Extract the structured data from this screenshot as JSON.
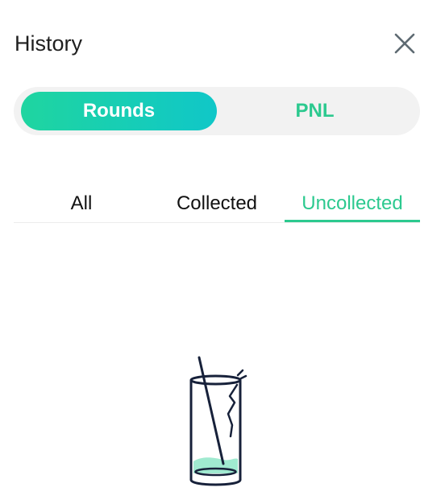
{
  "header": {
    "title": "History"
  },
  "segment": {
    "options": [
      "Rounds",
      "PNL"
    ],
    "selected": "Rounds"
  },
  "tabs": {
    "items": [
      "All",
      "Collected",
      "Uncollected"
    ],
    "selected": "Uncollected"
  },
  "icons": {
    "close": "close-icon",
    "empty_state": "empty-glass-icon"
  },
  "colors": {
    "accent": "#2cc98f",
    "gradient_start": "#1fd5a0",
    "gradient_end": "#10c7c8",
    "segment_bg": "#f2f2f2",
    "text": "#1f1f1f"
  }
}
